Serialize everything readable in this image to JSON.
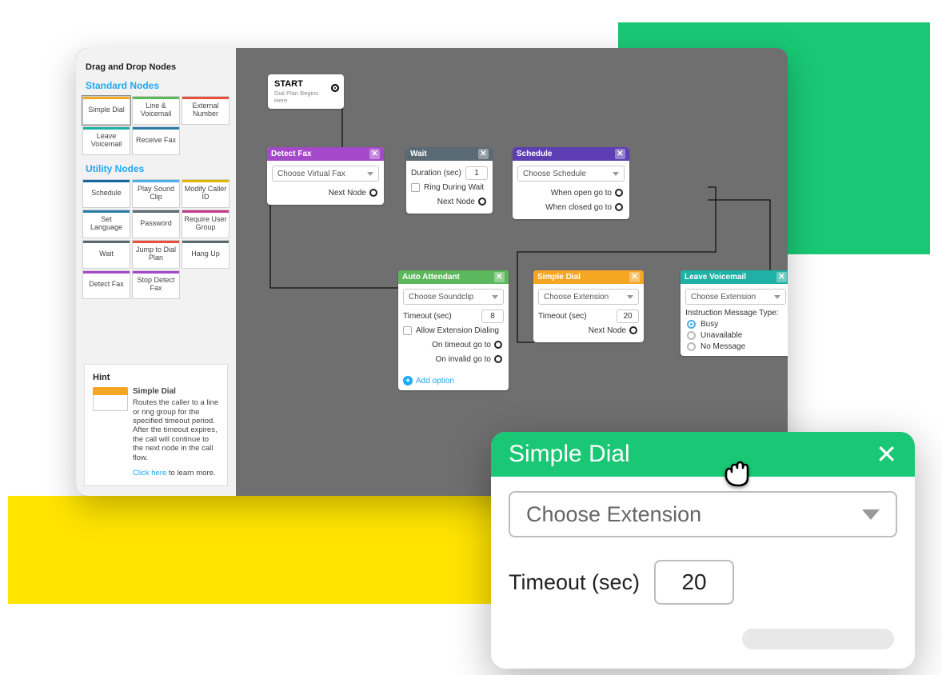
{
  "sidebar": {
    "heading": "Drag and Drop Nodes",
    "standard_title": "Standard Nodes",
    "utility_title": "Utility Nodes",
    "standard": [
      {
        "label": "Simple Dial",
        "color": "orange"
      },
      {
        "label": "Line & Voicemail",
        "color": "green"
      },
      {
        "label": "External Number",
        "color": "red"
      },
      {
        "label": "Leave Voicemail",
        "color": "teal"
      },
      {
        "label": "Receive Fax",
        "color": "blue"
      }
    ],
    "utility": [
      {
        "label": "Schedule",
        "color": "dblue"
      },
      {
        "label": "Play Sound Clip",
        "color": "lblue"
      },
      {
        "label": "Modify Caller ID",
        "color": "yellow"
      },
      {
        "label": "Set Language",
        "color": "blue"
      },
      {
        "label": "Password",
        "color": "gray"
      },
      {
        "label": "Require User Group",
        "color": "magenta"
      },
      {
        "label": "Wait",
        "color": "gray"
      },
      {
        "label": "Jump to Dial Plan",
        "color": "red"
      },
      {
        "label": "Hang Up",
        "color": "gray"
      },
      {
        "label": "Detect Fax",
        "color": "purple"
      },
      {
        "label": "Stop Detect Fax",
        "color": "purple"
      }
    ]
  },
  "hint": {
    "heading": "Hint",
    "title": "Simple Dial",
    "text": "Routes the caller to a line or ring group for the specified timeout period. After the timeout expires, the call will continue to the next node in the call flow.",
    "link": "Click here",
    "link_suffix": " to learn more."
  },
  "start": {
    "title": "START",
    "subtitle": "Dial Plan Begins Here"
  },
  "canvas": {
    "detect_fax": {
      "title": "Detect Fax",
      "select": "Choose Virtual Fax",
      "next": "Next Node"
    },
    "wait": {
      "title": "Wait",
      "duration_label": "Duration (sec)",
      "duration_value": "1",
      "ring_label": "Ring During Wait",
      "next": "Next Node"
    },
    "schedule": {
      "title": "Schedule",
      "select": "Choose Schedule",
      "open": "When open go to",
      "closed": "When closed go to"
    },
    "auto_attendant": {
      "title": "Auto Attendant",
      "select": "Choose Soundclip",
      "timeout_label": "Timeout (sec)",
      "timeout_value": "8",
      "allow_ext": "Allow Extension Dialing",
      "on_timeout": "On timeout go to",
      "on_invalid": "On invalid go to",
      "add_option": "Add option"
    },
    "simple_dial": {
      "title": "Simple Dial",
      "select": "Choose Extension",
      "timeout_label": "Timeout (sec)",
      "timeout_value": "20",
      "next": "Next Node"
    },
    "leave_vm": {
      "title": "Leave Voicemail",
      "select": "Choose Extension",
      "instruction": "Instruction Message Type:",
      "busy": "Busy",
      "unavailable": "Unavailable",
      "no_msg": "No Message"
    }
  },
  "detail": {
    "title": "Simple Dial",
    "select": "Choose Extension",
    "timeout_label": "Timeout (sec)",
    "timeout_value": "20"
  }
}
